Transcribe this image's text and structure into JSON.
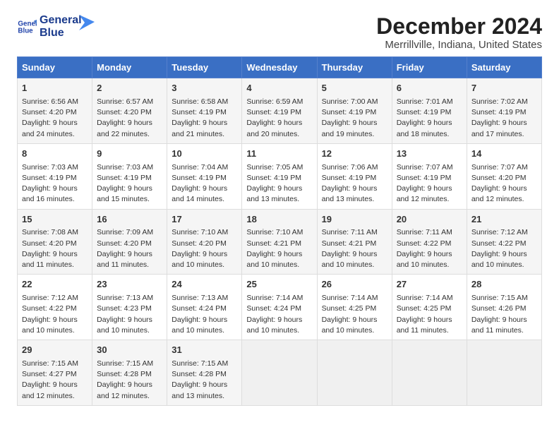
{
  "logo": {
    "line1": "General",
    "line2": "Blue"
  },
  "title": "December 2024",
  "subtitle": "Merrillville, Indiana, United States",
  "weekdays": [
    "Sunday",
    "Monday",
    "Tuesday",
    "Wednesday",
    "Thursday",
    "Friday",
    "Saturday"
  ],
  "weeks": [
    [
      {
        "day": "1",
        "sunrise": "Sunrise: 6:56 AM",
        "sunset": "Sunset: 4:20 PM",
        "daylight": "Daylight: 9 hours and 24 minutes."
      },
      {
        "day": "2",
        "sunrise": "Sunrise: 6:57 AM",
        "sunset": "Sunset: 4:20 PM",
        "daylight": "Daylight: 9 hours and 22 minutes."
      },
      {
        "day": "3",
        "sunrise": "Sunrise: 6:58 AM",
        "sunset": "Sunset: 4:19 PM",
        "daylight": "Daylight: 9 hours and 21 minutes."
      },
      {
        "day": "4",
        "sunrise": "Sunrise: 6:59 AM",
        "sunset": "Sunset: 4:19 PM",
        "daylight": "Daylight: 9 hours and 20 minutes."
      },
      {
        "day": "5",
        "sunrise": "Sunrise: 7:00 AM",
        "sunset": "Sunset: 4:19 PM",
        "daylight": "Daylight: 9 hours and 19 minutes."
      },
      {
        "day": "6",
        "sunrise": "Sunrise: 7:01 AM",
        "sunset": "Sunset: 4:19 PM",
        "daylight": "Daylight: 9 hours and 18 minutes."
      },
      {
        "day": "7",
        "sunrise": "Sunrise: 7:02 AM",
        "sunset": "Sunset: 4:19 PM",
        "daylight": "Daylight: 9 hours and 17 minutes."
      }
    ],
    [
      {
        "day": "8",
        "sunrise": "Sunrise: 7:03 AM",
        "sunset": "Sunset: 4:19 PM",
        "daylight": "Daylight: 9 hours and 16 minutes."
      },
      {
        "day": "9",
        "sunrise": "Sunrise: 7:03 AM",
        "sunset": "Sunset: 4:19 PM",
        "daylight": "Daylight: 9 hours and 15 minutes."
      },
      {
        "day": "10",
        "sunrise": "Sunrise: 7:04 AM",
        "sunset": "Sunset: 4:19 PM",
        "daylight": "Daylight: 9 hours and 14 minutes."
      },
      {
        "day": "11",
        "sunrise": "Sunrise: 7:05 AM",
        "sunset": "Sunset: 4:19 PM",
        "daylight": "Daylight: 9 hours and 13 minutes."
      },
      {
        "day": "12",
        "sunrise": "Sunrise: 7:06 AM",
        "sunset": "Sunset: 4:19 PM",
        "daylight": "Daylight: 9 hours and 13 minutes."
      },
      {
        "day": "13",
        "sunrise": "Sunrise: 7:07 AM",
        "sunset": "Sunset: 4:19 PM",
        "daylight": "Daylight: 9 hours and 12 minutes."
      },
      {
        "day": "14",
        "sunrise": "Sunrise: 7:07 AM",
        "sunset": "Sunset: 4:20 PM",
        "daylight": "Daylight: 9 hours and 12 minutes."
      }
    ],
    [
      {
        "day": "15",
        "sunrise": "Sunrise: 7:08 AM",
        "sunset": "Sunset: 4:20 PM",
        "daylight": "Daylight: 9 hours and 11 minutes."
      },
      {
        "day": "16",
        "sunrise": "Sunrise: 7:09 AM",
        "sunset": "Sunset: 4:20 PM",
        "daylight": "Daylight: 9 hours and 11 minutes."
      },
      {
        "day": "17",
        "sunrise": "Sunrise: 7:10 AM",
        "sunset": "Sunset: 4:20 PM",
        "daylight": "Daylight: 9 hours and 10 minutes."
      },
      {
        "day": "18",
        "sunrise": "Sunrise: 7:10 AM",
        "sunset": "Sunset: 4:21 PM",
        "daylight": "Daylight: 9 hours and 10 minutes."
      },
      {
        "day": "19",
        "sunrise": "Sunrise: 7:11 AM",
        "sunset": "Sunset: 4:21 PM",
        "daylight": "Daylight: 9 hours and 10 minutes."
      },
      {
        "day": "20",
        "sunrise": "Sunrise: 7:11 AM",
        "sunset": "Sunset: 4:22 PM",
        "daylight": "Daylight: 9 hours and 10 minutes."
      },
      {
        "day": "21",
        "sunrise": "Sunrise: 7:12 AM",
        "sunset": "Sunset: 4:22 PM",
        "daylight": "Daylight: 9 hours and 10 minutes."
      }
    ],
    [
      {
        "day": "22",
        "sunrise": "Sunrise: 7:12 AM",
        "sunset": "Sunset: 4:22 PM",
        "daylight": "Daylight: 9 hours and 10 minutes."
      },
      {
        "day": "23",
        "sunrise": "Sunrise: 7:13 AM",
        "sunset": "Sunset: 4:23 PM",
        "daylight": "Daylight: 9 hours and 10 minutes."
      },
      {
        "day": "24",
        "sunrise": "Sunrise: 7:13 AM",
        "sunset": "Sunset: 4:24 PM",
        "daylight": "Daylight: 9 hours and 10 minutes."
      },
      {
        "day": "25",
        "sunrise": "Sunrise: 7:14 AM",
        "sunset": "Sunset: 4:24 PM",
        "daylight": "Daylight: 9 hours and 10 minutes."
      },
      {
        "day": "26",
        "sunrise": "Sunrise: 7:14 AM",
        "sunset": "Sunset: 4:25 PM",
        "daylight": "Daylight: 9 hours and 10 minutes."
      },
      {
        "day": "27",
        "sunrise": "Sunrise: 7:14 AM",
        "sunset": "Sunset: 4:25 PM",
        "daylight": "Daylight: 9 hours and 11 minutes."
      },
      {
        "day": "28",
        "sunrise": "Sunrise: 7:15 AM",
        "sunset": "Sunset: 4:26 PM",
        "daylight": "Daylight: 9 hours and 11 minutes."
      }
    ],
    [
      {
        "day": "29",
        "sunrise": "Sunrise: 7:15 AM",
        "sunset": "Sunset: 4:27 PM",
        "daylight": "Daylight: 9 hours and 12 minutes."
      },
      {
        "day": "30",
        "sunrise": "Sunrise: 7:15 AM",
        "sunset": "Sunset: 4:28 PM",
        "daylight": "Daylight: 9 hours and 12 minutes."
      },
      {
        "day": "31",
        "sunrise": "Sunrise: 7:15 AM",
        "sunset": "Sunset: 4:28 PM",
        "daylight": "Daylight: 9 hours and 13 minutes."
      },
      null,
      null,
      null,
      null
    ]
  ]
}
